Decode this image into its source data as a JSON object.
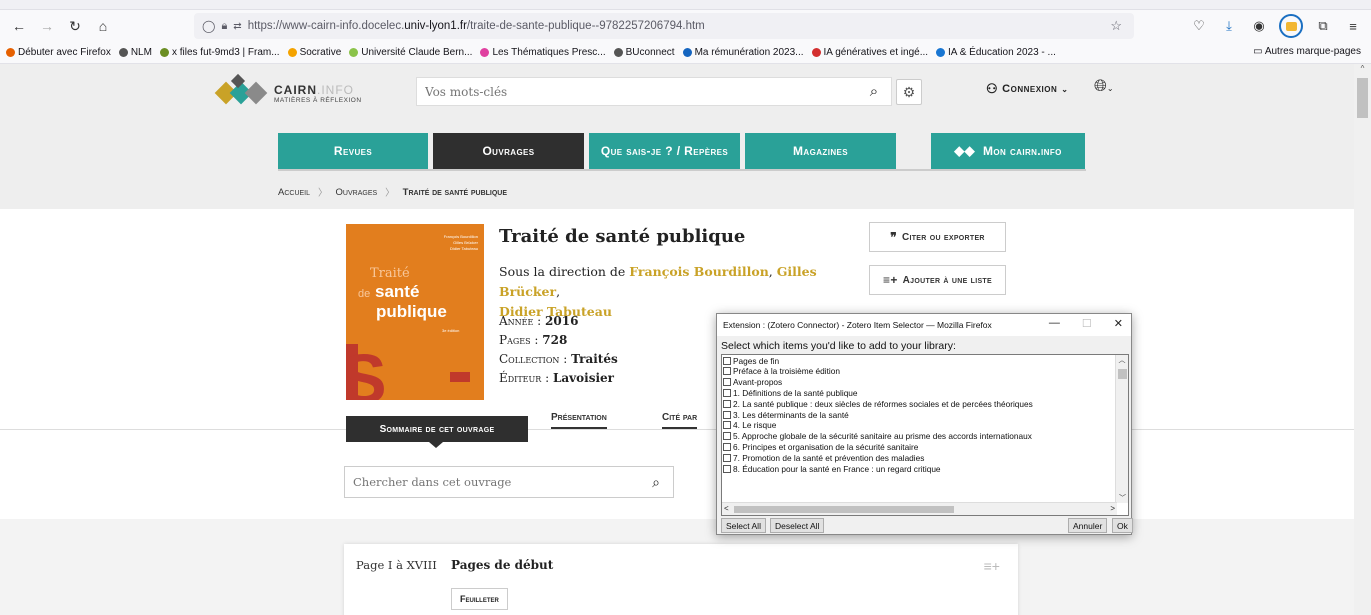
{
  "browser": {
    "url_prefix": "https://www-cairn-info.docelec.",
    "url_host": "univ-lyon1.fr",
    "url_suffix": "/traite-de-sante-publique--9782257206794.htm",
    "bookmarks": [
      {
        "label": "Débuter avec Firefox",
        "color": "#e66000"
      },
      {
        "label": "NLM",
        "color": "#555555"
      },
      {
        "label": "x files fut-9md3 | Fram...",
        "color": "#6b8e23"
      },
      {
        "label": "Socrative",
        "color": "#f4a300"
      },
      {
        "label": "Université Claude Bern...",
        "color": "#8bc34a"
      },
      {
        "label": "Les Thématiques Presc...",
        "color": "#e040a0"
      },
      {
        "label": "BUconnect",
        "color": "#555555"
      },
      {
        "label": "Ma rémunération 2023...",
        "color": "#1565c0"
      },
      {
        "label": "IA génératives et ingé...",
        "color": "#d32f2f"
      },
      {
        "label": "IA & Éducation 2023 - ...",
        "color": "#1976d2"
      }
    ],
    "other_bookmarks": "Autres marque-pages"
  },
  "site": {
    "logo_main": "CAIRN",
    "logo_dot": ".INFO",
    "logo_tagline": "MATIÈRES À RÉFLEXION",
    "search_placeholder": "Vos mots-clés",
    "connexion": "Connexion",
    "nav": [
      {
        "label": "Revues",
        "width": 150
      },
      {
        "label": "Ouvrages",
        "width": 151
      },
      {
        "label": "Que sais-je ? / Repères",
        "width": 151
      },
      {
        "label": "Magazines",
        "width": 151
      },
      {
        "label": "Mon cairn.info",
        "width": 151
      }
    ],
    "breadcrumb": {
      "home": "Accueil",
      "section": "Ouvrages",
      "current": "Traité de santé publique"
    }
  },
  "book": {
    "title": "Traité de santé publique",
    "direction_prefix": "Sous la direction de",
    "authors": [
      "François Bourdillon",
      "Gilles Brücker",
      "Didier Tabuteau"
    ],
    "meta": [
      {
        "key": "Année :",
        "value": "2016"
      },
      {
        "key": "Pages :",
        "value": "728"
      },
      {
        "key": "Collection :",
        "value": "Traités"
      },
      {
        "key": "Éditeur :",
        "value": "Lavoisier"
      }
    ],
    "cover": {
      "authors": [
        "François Bourdillon",
        "Gilles Brücker",
        "Didier Tabuteau"
      ],
      "line1": "Traité",
      "line2_small": "de",
      "line2": "santé",
      "line3": "publique",
      "edition": "3e édition",
      "big_letter": "S"
    },
    "cite_label": "Citer ou exporter",
    "list_label": "Ajouter à une liste"
  },
  "tabs": {
    "summary": "Sommaire de cet ouvrage",
    "presentation": "Présentation",
    "cited": "Cité par"
  },
  "toc": {
    "search_placeholder": "Chercher dans cet ouvrage",
    "first": {
      "pages": "Page I à XVIII",
      "title": "Pages de début",
      "button": "Feuilleter"
    }
  },
  "dialog": {
    "title": "Extension : (Zotero Connector) - Zotero Item Selector — Mozilla Firefox",
    "prompt": "Select which items you'd like to add to your library:",
    "items": [
      "Pages de fin",
      "Préface à la troisième édition",
      "Avant-propos",
      "1. Définitions de la santé publique",
      "2. La santé publique : deux siècles de réformes sociales et de percées théoriques",
      "3. Les déterminants de la santé",
      "4. Le risque",
      "5. Approche globale de la sécurité sanitaire au prisme des accords internationaux",
      "6. Principes et organisation de la sécurité sanitaire",
      "7. Promotion de la santé et prévention des maladies",
      "8. Éducation pour la santé en France : un regard critique"
    ],
    "select_all": "Select All",
    "deselect_all": "Deselect All",
    "cancel": "Annuler",
    "ok": "Ok"
  },
  "colors": {
    "teal": "#2aa198",
    "dark": "#2f2f2f",
    "gold": "#c9a227",
    "cover": "#e27e1e"
  }
}
